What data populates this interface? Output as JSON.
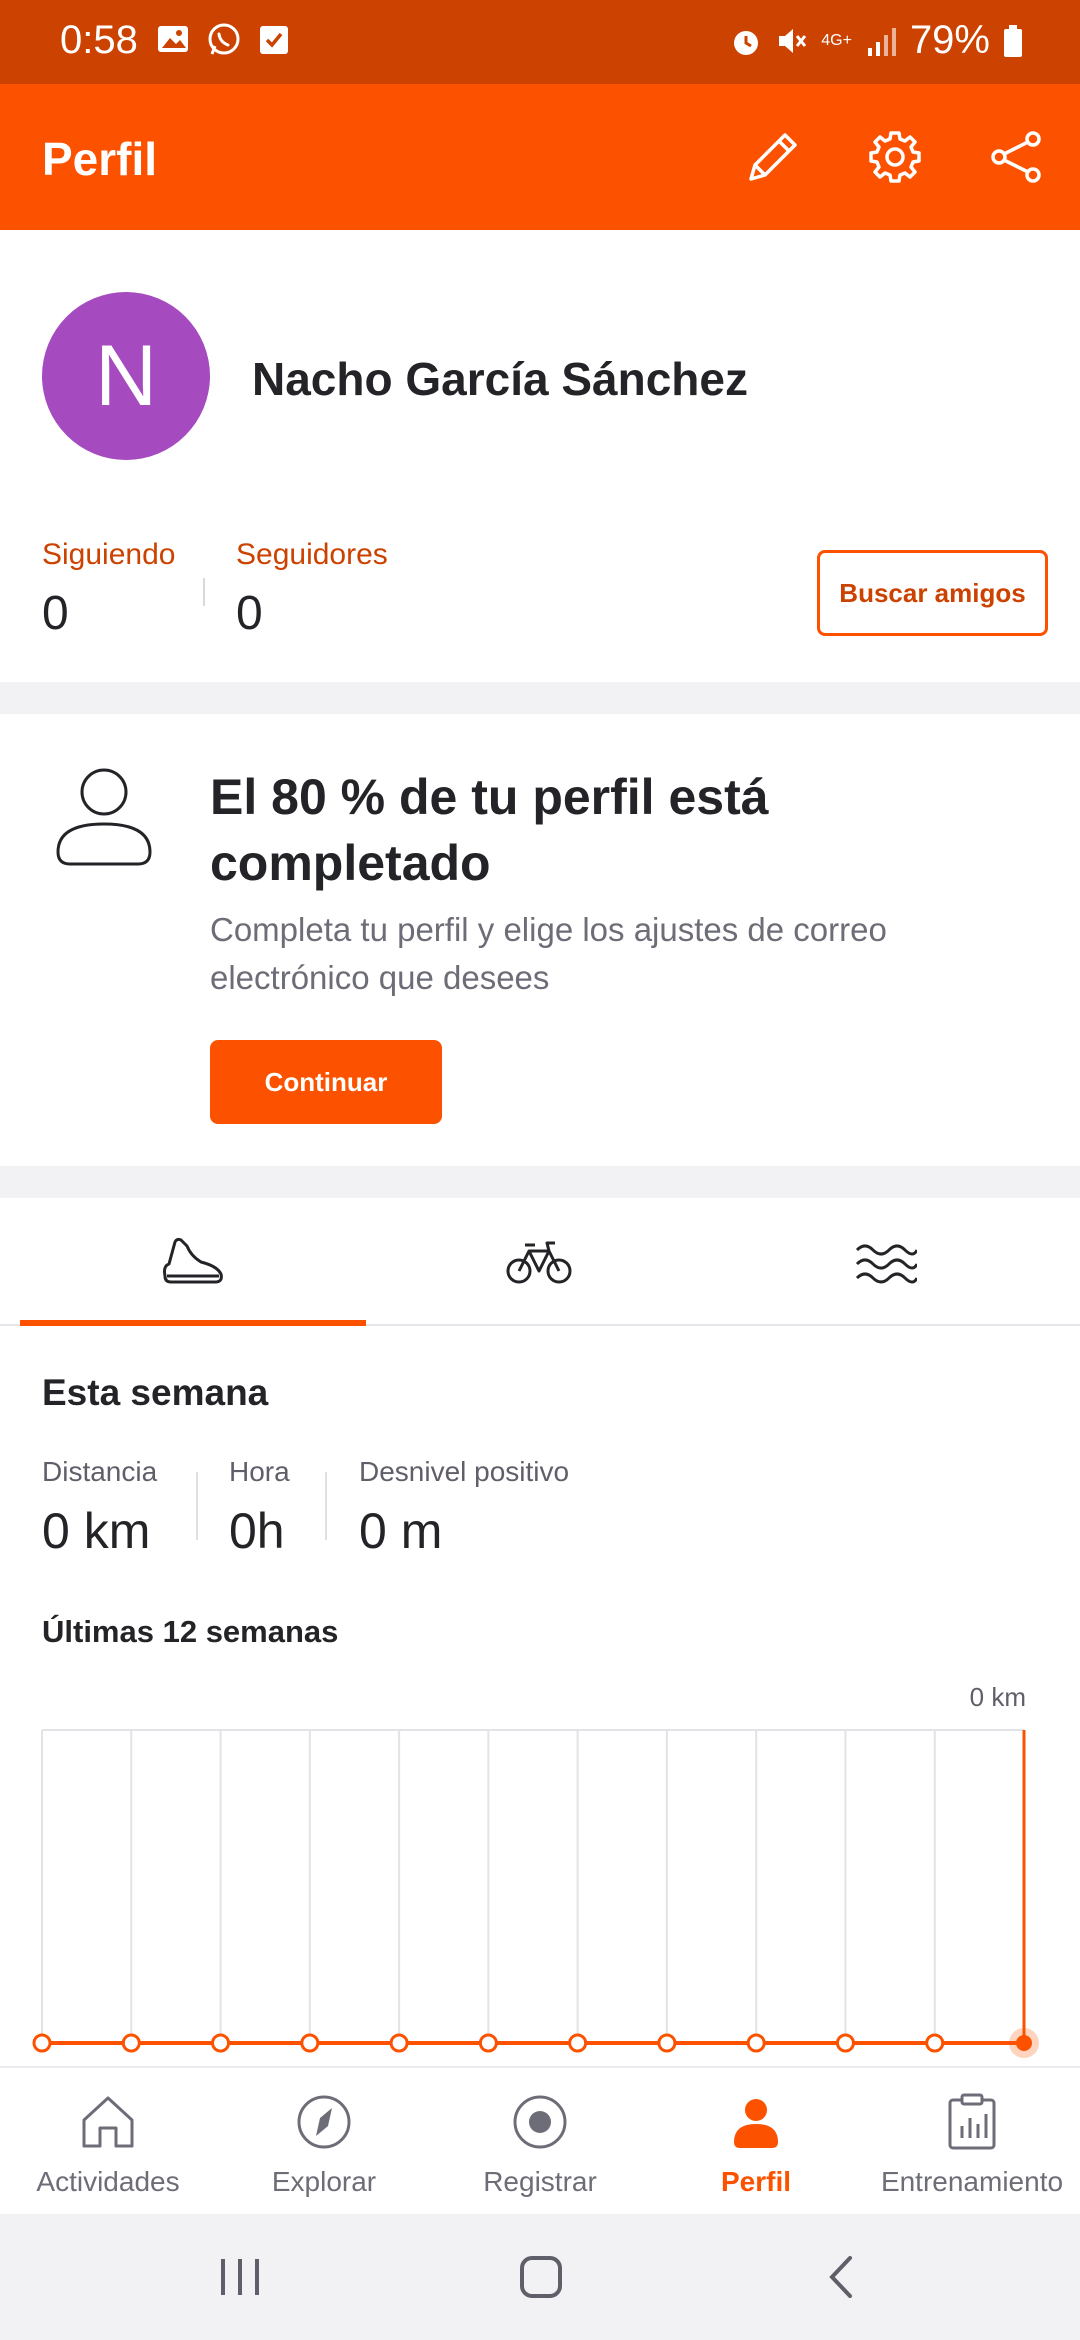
{
  "status_bar": {
    "time": "0:58",
    "battery": "79%",
    "network": "4G+"
  },
  "app_bar": {
    "title": "Perfil",
    "actions": [
      "edit-icon",
      "settings-icon",
      "share-icon"
    ]
  },
  "profile": {
    "avatar_initial": "N",
    "avatar_color": "#a64ac0",
    "name": "Nacho García Sánchez",
    "following_label": "Siguiendo",
    "following_value": "0",
    "followers_label": "Seguidores",
    "followers_value": "0",
    "find_friends_label": "Buscar amigos"
  },
  "completion": {
    "title": "El 80 % de tu perfil está completado",
    "description": "Completa tu perfil y elige los ajustes de correo electrónico que desees",
    "continue_label": "Continuar"
  },
  "sport_tabs": {
    "items": [
      "running-shoe-icon",
      "bike-icon",
      "swim-icon"
    ],
    "selected": 0
  },
  "week": {
    "title": "Esta semana",
    "distance_label": "Distancia",
    "distance_value": "0 km",
    "time_label": "Hora",
    "time_value": "0h",
    "elevation_label": "Desnivel positivo",
    "elevation_value": "0 m"
  },
  "last_weeks": {
    "title": "Últimas 12 semanas",
    "axis_max_label": "0 km"
  },
  "chart_data": {
    "type": "line",
    "x": [
      1,
      2,
      3,
      4,
      5,
      6,
      7,
      8,
      9,
      10,
      11,
      12
    ],
    "series": [
      {
        "values": [
          0,
          0,
          0,
          0,
          0,
          0,
          0,
          0,
          0,
          0,
          0,
          0
        ]
      }
    ],
    "ylabel": "",
    "xlabel": ""
  },
  "bottom_nav": {
    "items": [
      {
        "label": "Actividades",
        "icon": "home-icon"
      },
      {
        "label": "Explorar",
        "icon": "compass-icon"
      },
      {
        "label": "Registrar",
        "icon": "record-icon"
      },
      {
        "label": "Perfil",
        "icon": "profile-icon"
      },
      {
        "label": "Entrenamiento",
        "icon": "training-icon"
      }
    ],
    "active": 3
  },
  "colors": {
    "accent": "#fc5200",
    "status_bar": "#cc4200"
  }
}
